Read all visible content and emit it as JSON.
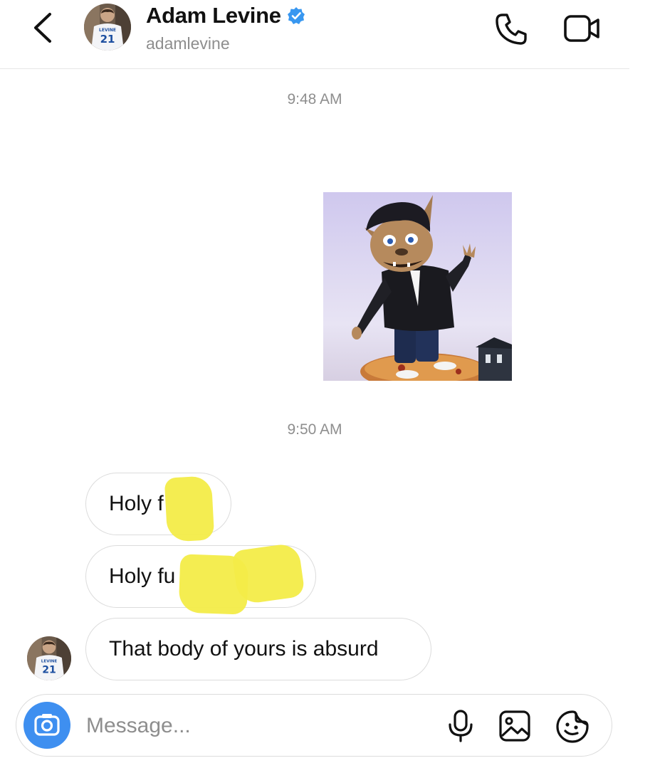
{
  "header": {
    "name": "Adam Levine",
    "handle": "adamlevine",
    "verified": true,
    "avatar_jersey_name": "LEVINE",
    "avatar_jersey_number": "21",
    "icons": {
      "back": "chevron-left-icon",
      "verified": "verified-badge-icon",
      "call": "phone-icon",
      "video": "video-camera-icon"
    }
  },
  "thread": {
    "timestamps": [
      "9:48 AM",
      "9:50 AM"
    ],
    "shared_photo": "cartoon werewolf in black leather jacket standing on a pizza",
    "messages": [
      {
        "text": "Holy f",
        "censored": true
      },
      {
        "text": "Holy fu",
        "censored": true
      },
      {
        "text": "That body of yours is absurd",
        "censored": false
      }
    ]
  },
  "composer": {
    "placeholder": "Message...",
    "value": "",
    "icons": {
      "camera": "camera-icon",
      "mic": "microphone-icon",
      "gallery": "image-gallery-icon",
      "sticker": "sticker-icon"
    }
  },
  "colors": {
    "accent": "#3e8ff0",
    "verified": "#3897f0",
    "censor_highlight": "#f3ec48",
    "secondary_text": "#8e8e8e",
    "bubble_border": "#dcdcdc"
  }
}
